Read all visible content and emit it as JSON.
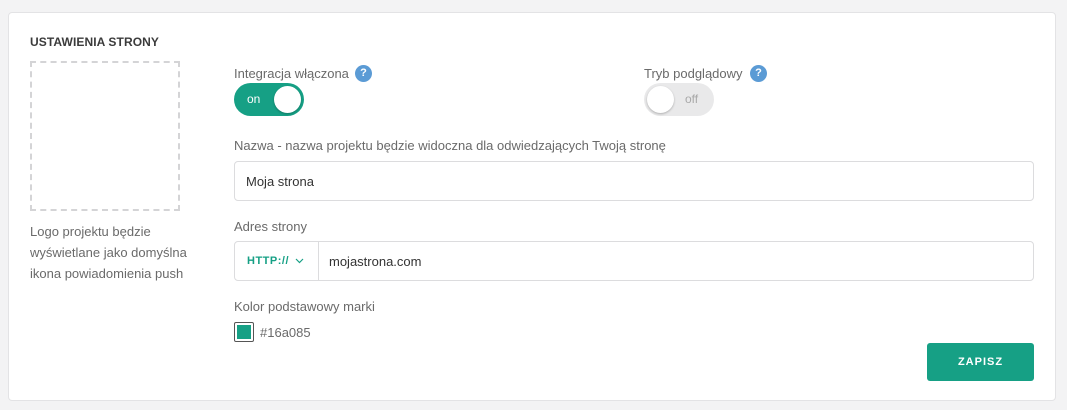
{
  "section": {
    "title": "USTAWIENIA STRONY"
  },
  "logo": {
    "caption": "Logo projektu będzie wyświetlane jako domyślna ikona powiadomienia push"
  },
  "integration": {
    "label": "Integracja włączona",
    "help": "?",
    "toggle_text": "on",
    "enabled": true
  },
  "preview": {
    "label": "Tryb podglądowy",
    "help": "?",
    "toggle_text": "off",
    "enabled": false
  },
  "name_field": {
    "label": "Nazwa - nazwa projektu będzie widoczna dla odwiedzających Twoją stronę",
    "value": "Moja strona"
  },
  "address_field": {
    "label": "Adres strony",
    "protocol": "HTTP://",
    "value": "mojastrona.com"
  },
  "brand_color": {
    "label": "Kolor podstawowy marki",
    "value": "#16a085"
  },
  "actions": {
    "save_label": "ZAPISZ"
  },
  "colors": {
    "accent": "#16a085",
    "help_icon": "#5b9bd5"
  },
  "icons": {
    "help": "help-icon",
    "protocol_dropdown": "chevron-down-icon"
  }
}
